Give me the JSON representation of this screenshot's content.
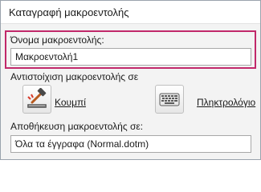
{
  "window": {
    "title": "Καταγραφή μακροεντολής"
  },
  "macro_name": {
    "label": "Όνομα μακροεντολής:",
    "value": "Μακροεντολή1"
  },
  "assign": {
    "label": "Αντιστοίχιση μακροεντολής σε",
    "button_label": "Κουμπί",
    "keyboard_label": "Πληκτρολόγιο"
  },
  "store": {
    "label": "Αποθήκευση μακροεντολής σε:",
    "value": "Όλα τα έγγραφα (Normal.dotm)"
  },
  "colors": {
    "highlight": "#c1286a"
  },
  "icons": {
    "button": "hammer-button-icon",
    "keyboard": "keyboard-icon"
  }
}
